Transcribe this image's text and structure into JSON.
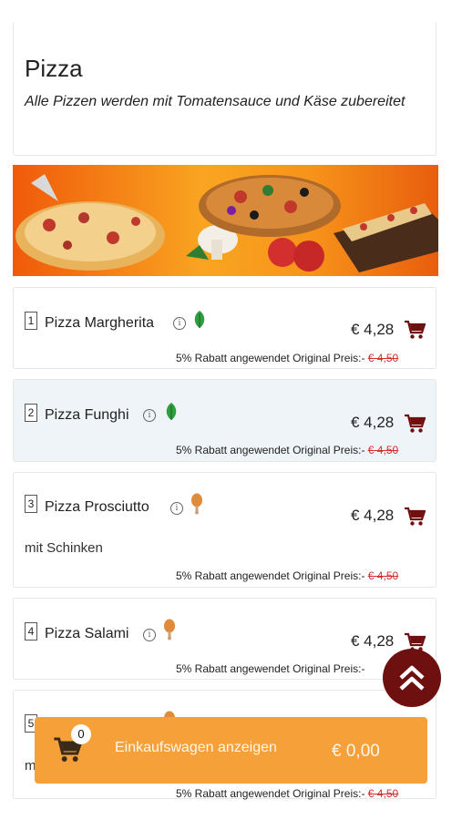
{
  "category": {
    "title": "Pizza",
    "description": "Alle Pizzen werden mit Tomatensauce und Käse zubereitet"
  },
  "discount_text": "5% Rabatt angewendet Original Preis:-",
  "items": [
    {
      "number": "1",
      "name": "Pizza Margherita",
      "badge": "leaf-icon",
      "badge_color": "#2e9e3e",
      "price": "€ 4,28",
      "original_price": "€ 4,50",
      "subtitle": ""
    },
    {
      "number": "2",
      "name": "Pizza Funghi",
      "badge": "leaf-icon",
      "badge_color": "#2e9e3e",
      "price": "€ 4,28",
      "original_price": "€ 4,50",
      "subtitle": ""
    },
    {
      "number": "3",
      "name": "Pizza Prosciutto",
      "badge": "chicken-leg-icon",
      "badge_color": "#e08a3c",
      "price": "€ 4,28",
      "original_price": "€ 4,50",
      "subtitle": "mit Schinken"
    },
    {
      "number": "4",
      "name": "Pizza Salami",
      "badge": "chicken-leg-icon",
      "badge_color": "#e08a3c",
      "price": "€ 4,28",
      "original_price": "",
      "subtitle": ""
    },
    {
      "number": "5",
      "name": "",
      "badge": "chicken-leg-icon",
      "badge_color": "#e08a3c",
      "price": "",
      "original_price": "€ 4,50",
      "subtitle": "m"
    }
  ],
  "cart_bar": {
    "count": "0",
    "label": "Einkaufswagen anzeigen",
    "total": "€ 0,00"
  },
  "colors": {
    "accent_orange": "#f6a03a",
    "scroll_top": "#6e1010",
    "cart_icon": "#6e1010",
    "strike_price": "#d32f2f",
    "alt_row": "#eef4f8"
  }
}
